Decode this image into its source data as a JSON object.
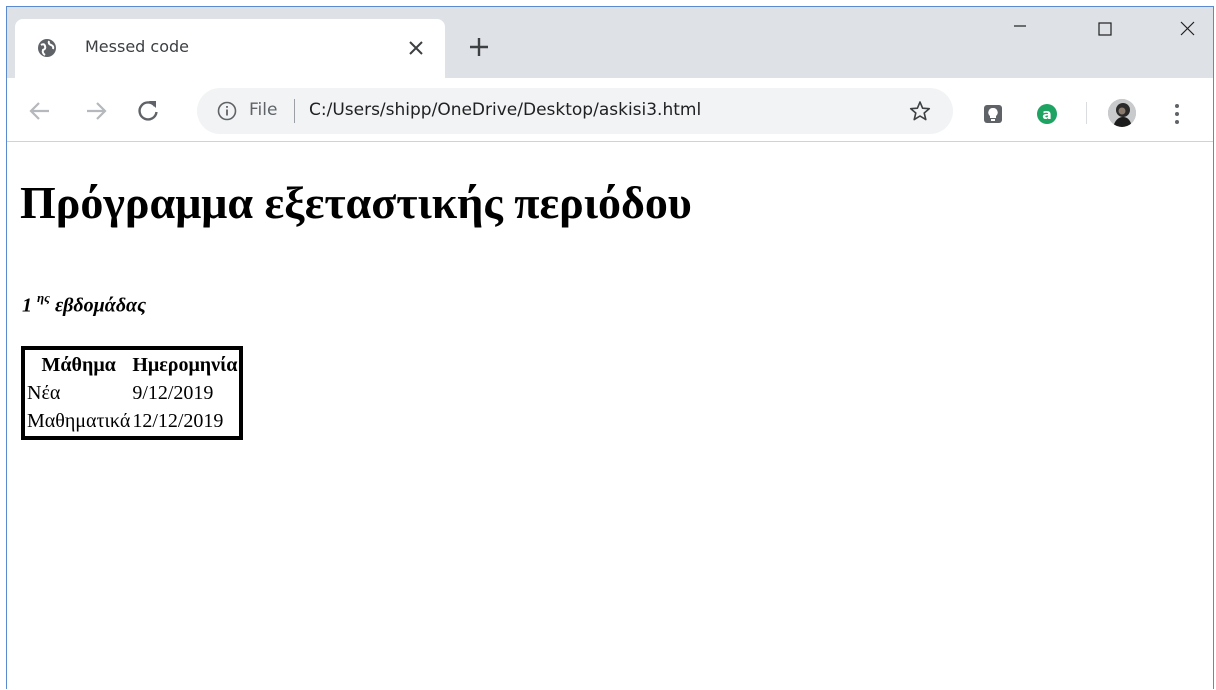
{
  "browser": {
    "tab": {
      "title": "Messed code"
    },
    "address": {
      "scheme_label": "File",
      "url": "C:/Users/shipp/OneDrive/Desktop/askisi3.html"
    },
    "icons": {
      "tab": "globe-icon",
      "close": "close-icon",
      "new_tab": "plus-icon",
      "back": "arrow-left-icon",
      "forward": "arrow-right-icon",
      "reload": "reload-icon",
      "info": "info-icon",
      "bookmark": "star-icon",
      "extension1": "lightbulb-extension-icon",
      "extension2": "letter-a-extension-icon",
      "profile": "avatar",
      "menu": "kebab-menu-icon",
      "minimize": "minimize-icon",
      "maximize": "maximize-icon",
      "window_close": "close-icon"
    },
    "colors": {
      "titlebar": "#dee1e6",
      "omnibox": "#f1f3f4",
      "extension_green": "#1ea362"
    }
  },
  "page": {
    "heading": "Πρόγραμμα εξεταστικής περιόδου",
    "subheading": {
      "number": "1",
      "superscript": "ης",
      "text": "εβδομάδας"
    },
    "table": {
      "headers": [
        "Μάθημα",
        "Ημερομηνία"
      ],
      "rows": [
        [
          "Νέα",
          "9/12/2019"
        ],
        [
          "Μαθηματικά",
          "12/12/2019"
        ]
      ]
    }
  }
}
